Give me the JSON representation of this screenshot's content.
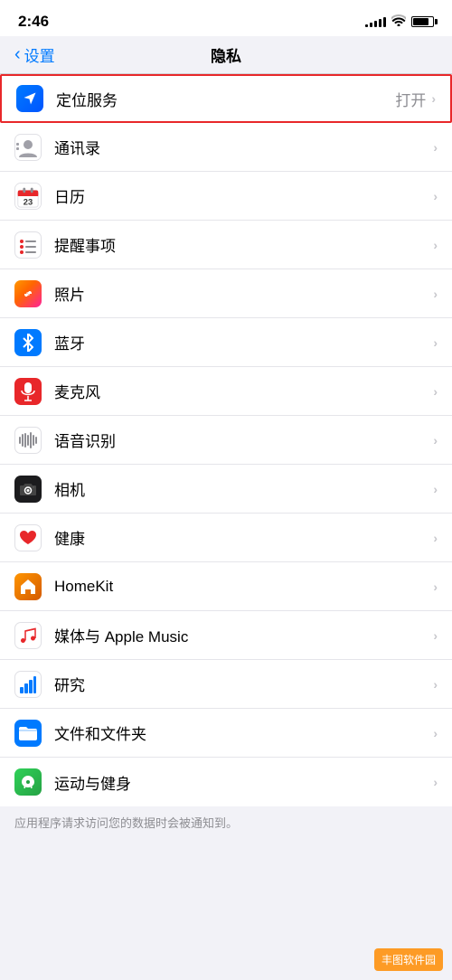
{
  "statusBar": {
    "time": "2:46",
    "signalBars": [
      3,
      5,
      7,
      9,
      11
    ],
    "batteryLevel": 80
  },
  "navBar": {
    "backLabel": "设置",
    "title": "隐私"
  },
  "settings": {
    "items": [
      {
        "id": "location",
        "label": "定位服务",
        "value": "打开",
        "iconBg": "location",
        "iconType": "location-arrow",
        "highlighted": true
      },
      {
        "id": "contacts",
        "label": "通讯录",
        "value": "",
        "iconBg": "contacts",
        "iconType": "contacts"
      },
      {
        "id": "calendar",
        "label": "日历",
        "value": "",
        "iconBg": "calendar",
        "iconType": "calendar"
      },
      {
        "id": "reminders",
        "label": "提醒事项",
        "value": "",
        "iconBg": "reminders",
        "iconType": "reminders"
      },
      {
        "id": "photos",
        "label": "照片",
        "value": "",
        "iconBg": "photos",
        "iconType": "photos"
      },
      {
        "id": "bluetooth",
        "label": "蓝牙",
        "value": "",
        "iconBg": "bluetooth",
        "iconType": "bluetooth"
      },
      {
        "id": "microphone",
        "label": "麦克风",
        "value": "",
        "iconBg": "microphone",
        "iconType": "microphone"
      },
      {
        "id": "speech",
        "label": "语音识别",
        "value": "",
        "iconBg": "speech",
        "iconType": "speech"
      },
      {
        "id": "camera",
        "label": "相机",
        "value": "",
        "iconBg": "camera",
        "iconType": "camera"
      },
      {
        "id": "health",
        "label": "健康",
        "value": "",
        "iconBg": "health",
        "iconType": "health"
      },
      {
        "id": "homekit",
        "label": "HomeKit",
        "value": "",
        "iconBg": "homekit",
        "iconType": "homekit"
      },
      {
        "id": "media",
        "label": "媒体与 Apple Music",
        "value": "",
        "iconBg": "media",
        "iconType": "media"
      },
      {
        "id": "research",
        "label": "研究",
        "value": "",
        "iconBg": "research",
        "iconType": "research"
      },
      {
        "id": "files",
        "label": "文件和文件夹",
        "value": "",
        "iconBg": "files",
        "iconType": "files"
      },
      {
        "id": "fitness",
        "label": "运动与健身",
        "value": "",
        "iconBg": "fitness",
        "iconType": "fitness"
      }
    ]
  },
  "bottomNote": "应用程序请求访问您的数据时会被通知到。",
  "watermark": "丰图软件园"
}
